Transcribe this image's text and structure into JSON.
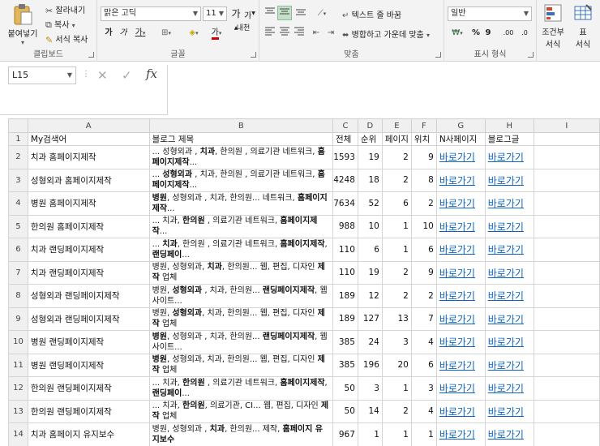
{
  "ribbon": {
    "clipboard": {
      "paste_label": "붙여넣기",
      "cut_label": "잘라내기",
      "copy_label": "복사",
      "format_painter_label": "서식 복사",
      "group_label": "클립보드"
    },
    "font": {
      "font_name": "맑은 고딕",
      "font_size": "11",
      "grow_label": "가",
      "shrink_label": "가",
      "bold_label": "가",
      "italic_label": "가",
      "underline_label": "가",
      "border_label": "⊞",
      "fill_label": "◈",
      "color_label": "가",
      "phonetic_label": "내천",
      "group_label": "글꼴"
    },
    "alignment": {
      "wrap_text_label": "텍스트 줄 바꿈",
      "merge_center_label": "병합하고 가운데 맞춤",
      "group_label": "맞춤"
    },
    "number": {
      "format_value": "일반",
      "currency_label": "₩",
      "percent_label": "%",
      "comma_label": "9",
      "inc_decimal_label": ".00",
      "dec_decimal_label": ".0",
      "group_label": "표시 형식"
    },
    "styles": {
      "conditional_label_1": "조건부",
      "conditional_label_2": "서식",
      "table_label_1": "표",
      "table_label_2": "서식"
    }
  },
  "formula_bar": {
    "name_box": "L15",
    "cancel_icon": "✕",
    "enter_icon": "✓",
    "fx_label": "fx",
    "formula_value": ""
  },
  "sheet": {
    "columns": [
      "A",
      "B",
      "C",
      "D",
      "E",
      "F",
      "G",
      "H",
      "I"
    ],
    "header_row": {
      "row_number": "1",
      "cells": [
        "My검색어",
        "블로그 제목",
        "전체",
        "순위",
        "페이지",
        "위치",
        "N사페이지",
        "블로그글",
        ""
      ]
    },
    "rows": [
      {
        "n": "2",
        "keyword": "치과 홈페이지제작",
        "title_html": "... 성형외과 , <b>치과</b>, 한의원 , 의료기관 네트워크, <b>홈페이지제작</b>...",
        "total": "1593",
        "rank": "19",
        "page": "2",
        "pos": "9",
        "link1": "바로가기",
        "link2": "바로가기"
      },
      {
        "n": "3",
        "keyword": "성형외과 홈페이지제작",
        "title_html": "... <b>성형외과</b> , 치과, 한의원 , 의료기관 네트워크, <b>홈페이지제작</b>...",
        "total": "4248",
        "rank": "18",
        "page": "2",
        "pos": "8",
        "link1": "바로가기",
        "link2": "바로가기"
      },
      {
        "n": "4",
        "keyword": "병원 홈페이지제작",
        "title_html": "<b>병원</b>, 성형외과 , 치과, 한의원... 네트워크, <b>홈페이지제작</b>...",
        "total": "7634",
        "rank": "52",
        "page": "6",
        "pos": "2",
        "link1": "바로가기",
        "link2": "바로가기"
      },
      {
        "n": "5",
        "keyword": "한의원 홈페이지제작",
        "title_html": "... 치과, <b>한의원</b> , 의료기관 네트워크, <b>홈페이지제작</b>...",
        "total": "988",
        "rank": "10",
        "page": "1",
        "pos": "10",
        "link1": "바로가기",
        "link2": "바로가기"
      },
      {
        "n": "6",
        "keyword": "치과 랜딩페이지제작",
        "title_html": "... <b>치과</b>, 한의원 , 의료기관 네트워크, <b>홈페이지제작</b>, <b>랜딩페이</b>...",
        "total": "110",
        "rank": "6",
        "page": "1",
        "pos": "6",
        "link1": "바로가기",
        "link2": "바로가기"
      },
      {
        "n": "7",
        "keyword": "치과 랜딩페이지제작",
        "title_html": "병원, 성형외과, <b>치과</b>, 한의원... 웹, 편집, 디자인 <b>제작</b> 업체",
        "total": "110",
        "rank": "19",
        "page": "2",
        "pos": "9",
        "link1": "바로가기",
        "link2": "바로가기"
      },
      {
        "n": "8",
        "keyword": "성형외과 랜딩페이지제작",
        "title_html": "병원, <b>성형외과</b> , 치과, 한의원... <b>랜딩페이지제작</b>, 웹사이트...",
        "total": "189",
        "rank": "12",
        "page": "2",
        "pos": "2",
        "link1": "바로가기",
        "link2": "바로가기"
      },
      {
        "n": "9",
        "keyword": "성형외과 랜딩페이지제작",
        "title_html": "병원, <b>성형외과</b>, 치과, 한의원... 웹, 편집, 디자인 <b>제작</b> 업체",
        "total": "189",
        "rank": "127",
        "page": "13",
        "pos": "7",
        "link1": "바로가기",
        "link2": "바로가기"
      },
      {
        "n": "10",
        "keyword": "병원 랜딩페이지제작",
        "title_html": "<b>병원</b>, 성형외과 , 치과, 한의원... <b>랜딩페이지제작</b>, 웹사이트...",
        "total": "385",
        "rank": "24",
        "page": "3",
        "pos": "4",
        "link1": "바로가기",
        "link2": "바로가기"
      },
      {
        "n": "11",
        "keyword": "병원 랜딩페이지제작",
        "title_html": "<b>병원</b>, 성형외과, 치과, 한의원... 웹, 편집, 디자인 <b>제작</b> 업체",
        "total": "385",
        "rank": "196",
        "page": "20",
        "pos": "6",
        "link1": "바로가기",
        "link2": "바로가기"
      },
      {
        "n": "12",
        "keyword": "한의원 랜딩페이지제작",
        "title_html": "... 치과, <b>한의원</b> , 의료기관 네트워크, <b>홈페이지제작</b>, <b>랜딩페이</b>...",
        "total": "50",
        "rank": "3",
        "page": "1",
        "pos": "3",
        "link1": "바로가기",
        "link2": "바로가기"
      },
      {
        "n": "13",
        "keyword": "한의원 랜딩페이지제작",
        "title_html": "... 치과, <b>한의원</b>, 의료기관, CI... 웹, 편집, 디자인 <b>제작</b> 업체",
        "total": "50",
        "rank": "14",
        "page": "2",
        "pos": "4",
        "link1": "바로가기",
        "link2": "바로가기"
      },
      {
        "n": "14",
        "keyword": "치과 홈페이지 유지보수",
        "title_html": "병원, 성형외과 , <b>치과</b>, 한의원... 제작, <b>홈페이지 유지보수</b>",
        "total": "967",
        "rank": "1",
        "page": "1",
        "pos": "1",
        "link1": "바로가기",
        "link2": "바로가기"
      }
    ]
  },
  "colors": {
    "link": "#0b63c1",
    "selected_align": "#c5e0c9",
    "header_bg": "#f0f0f0"
  }
}
